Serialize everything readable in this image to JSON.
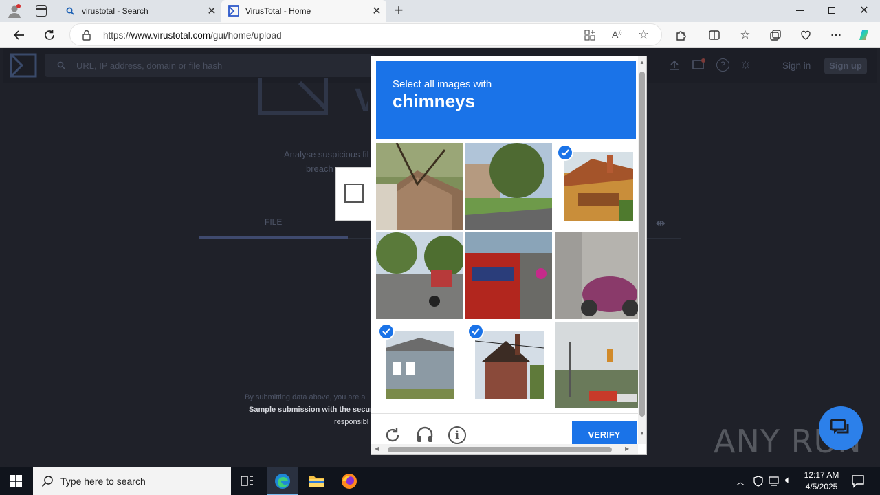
{
  "browser": {
    "tabs": [
      {
        "title": "virustotal - Search",
        "icon": "search-icon",
        "active": false
      },
      {
        "title": "VirusTotal - Home",
        "icon": "virustotal-logo-icon",
        "active": true
      }
    ],
    "address": {
      "prefix": "https://",
      "domain": "www.virustotal.com",
      "path": "/gui/home/upload"
    }
  },
  "vt": {
    "search_placeholder": "URL, IP address, domain or file hash",
    "sign_in": "Sign in",
    "sign_up": "Sign up",
    "tagline_line1": "Analyse suspicious fil",
    "tagline_line2": "breach",
    "tab_file": "FILE",
    "disclaimer_line1": "By submitting data above, you are a",
    "disclaimer_line2": "Sample submission with the secur",
    "disclaimer_line3": "responsibl"
  },
  "captcha": {
    "prompt": "Select all images with",
    "keyword": "chimneys",
    "verify_label": "VERIFY",
    "tiles": [
      {
        "name": "tile-1",
        "selected": false
      },
      {
        "name": "tile-2",
        "selected": false
      },
      {
        "name": "tile-3",
        "selected": true
      },
      {
        "name": "tile-4",
        "selected": false
      },
      {
        "name": "tile-5",
        "selected": false
      },
      {
        "name": "tile-6",
        "selected": false
      },
      {
        "name": "tile-7",
        "selected": true
      },
      {
        "name": "tile-8",
        "selected": true
      },
      {
        "name": "tile-9",
        "selected": false
      }
    ]
  },
  "watermark": "ANY RUN",
  "taskbar": {
    "search_placeholder": "Type here to search",
    "time": "12:17 AM",
    "date": "4/5/2025"
  },
  "colors": {
    "captcha_blue": "#1a73e8",
    "page_bg": "#1f2129"
  }
}
